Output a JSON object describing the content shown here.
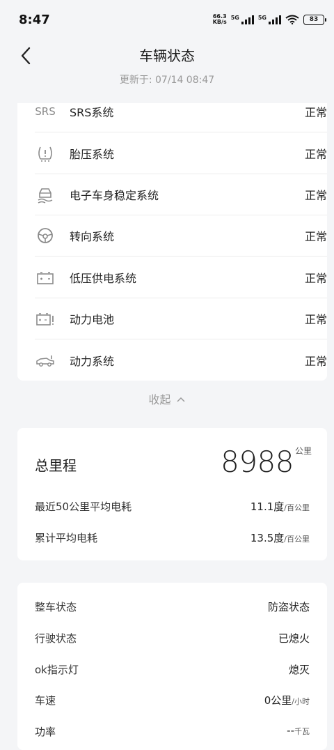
{
  "status_bar": {
    "time": "8:47",
    "net_speed_value": "66.3",
    "net_speed_unit": "KB/s",
    "sim1": "5G",
    "sim2": "5G",
    "battery": "83"
  },
  "header": {
    "title": "车辆状态",
    "updated": "更新于: 07/14 08:47"
  },
  "systems": [
    {
      "icon": "srs-icon",
      "icon_text": "SRS",
      "name": "SRS系统",
      "status": "正常"
    },
    {
      "icon": "tire-pressure-icon",
      "icon_text": "",
      "name": "胎压系统",
      "status": "正常"
    },
    {
      "icon": "stability-control-icon",
      "icon_text": "",
      "name": "电子车身稳定系统",
      "status": "正常"
    },
    {
      "icon": "steering-wheel-icon",
      "icon_text": "",
      "name": "转向系统",
      "status": "正常"
    },
    {
      "icon": "low-voltage-battery-icon",
      "icon_text": "",
      "name": "低压供电系统",
      "status": "正常"
    },
    {
      "icon": "power-battery-icon",
      "icon_text": "",
      "name": "动力电池",
      "status": "正常"
    },
    {
      "icon": "powertrain-icon",
      "icon_text": "",
      "name": "动力系统",
      "status": "正常"
    }
  ],
  "collapse_label": "收起",
  "mileage": {
    "label": "总里程",
    "value": "8988",
    "unit": "公里",
    "stats": [
      {
        "label": "最近50公里平均电耗",
        "value": "11.1度",
        "unit": "/百公里"
      },
      {
        "label": "累计平均电耗",
        "value": "13.5度",
        "unit": "/百公里"
      }
    ]
  },
  "vehicle": [
    {
      "label": "整车状态",
      "value": "防盗状态",
      "unit": ""
    },
    {
      "label": "行驶状态",
      "value": "已熄火",
      "unit": ""
    },
    {
      "label": "ok指示灯",
      "value": "熄灭",
      "unit": ""
    },
    {
      "label": "车速",
      "value": "0公里",
      "unit": "/小时"
    },
    {
      "label": "功率",
      "value": "--",
      "unit": "千瓦"
    }
  ]
}
